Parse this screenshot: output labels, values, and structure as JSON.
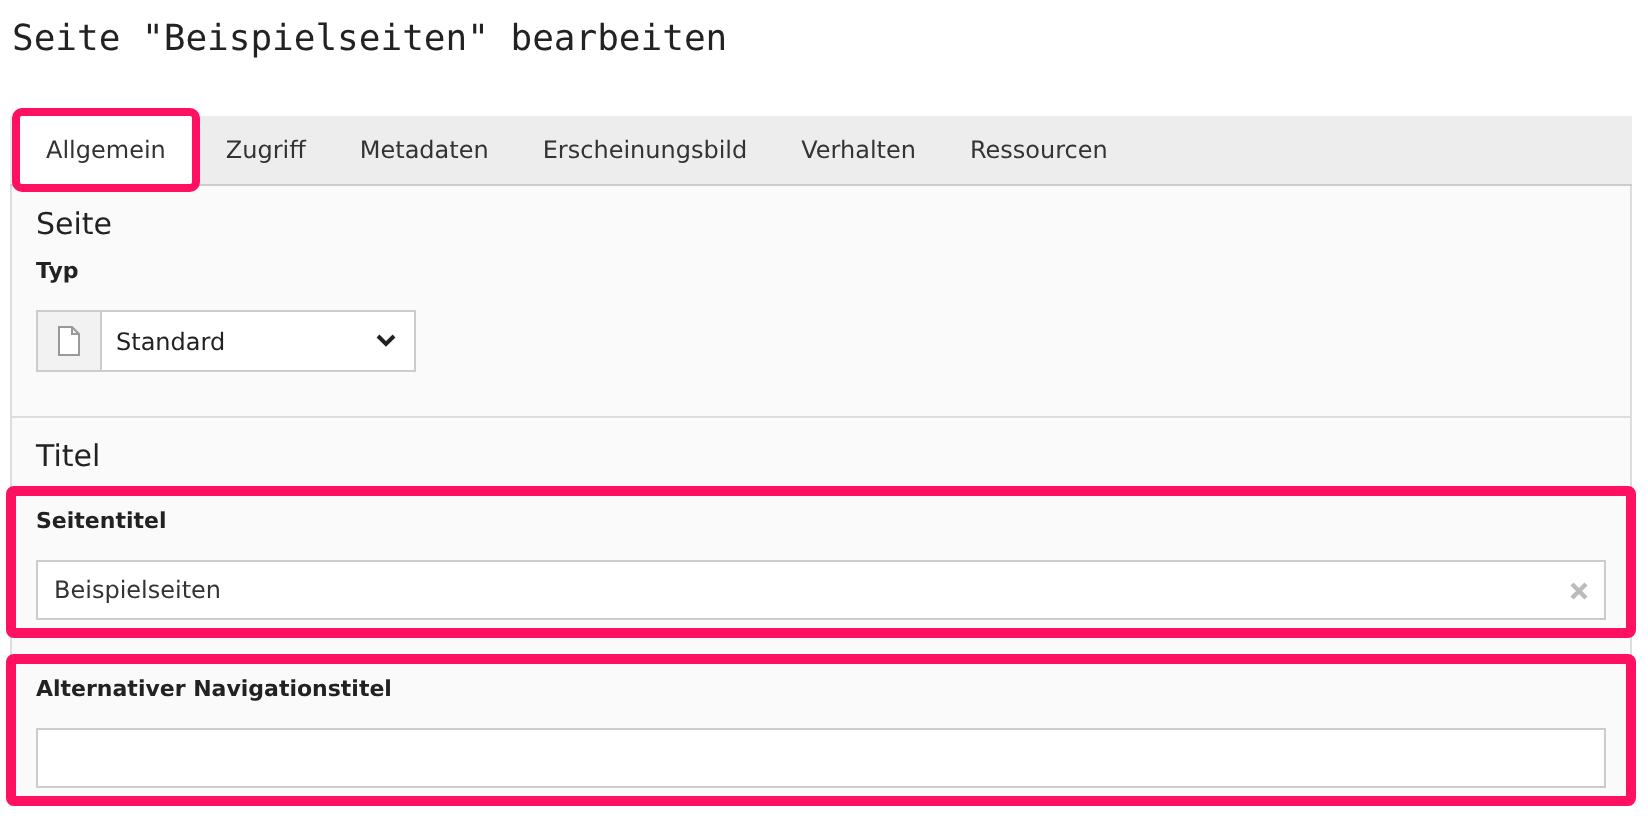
{
  "page_title": "Seite \"Beispielseiten\" bearbeiten",
  "tabs": [
    {
      "label": "Allgemein",
      "selected": true,
      "highlighted": true
    },
    {
      "label": "Zugriff",
      "selected": false,
      "highlighted": false
    },
    {
      "label": "Metadaten",
      "selected": false,
      "highlighted": false
    },
    {
      "label": "Erscheinungsbild",
      "selected": false,
      "highlighted": false
    },
    {
      "label": "Verhalten",
      "selected": false,
      "highlighted": false
    },
    {
      "label": "Ressourcen",
      "selected": false,
      "highlighted": false
    }
  ],
  "sections": [
    {
      "title": "Seite",
      "fields": [
        {
          "kind": "select",
          "label": "Typ",
          "value": "Standard",
          "highlighted": false
        }
      ]
    },
    {
      "title": "Titel",
      "fields": [
        {
          "kind": "text",
          "label": "Seitentitel",
          "value": "Beispielseiten",
          "clearable": true,
          "highlighted": true
        },
        {
          "kind": "text",
          "label": "Alternativer Navigationstitel",
          "highlighted": true
        }
      ]
    }
  ]
}
